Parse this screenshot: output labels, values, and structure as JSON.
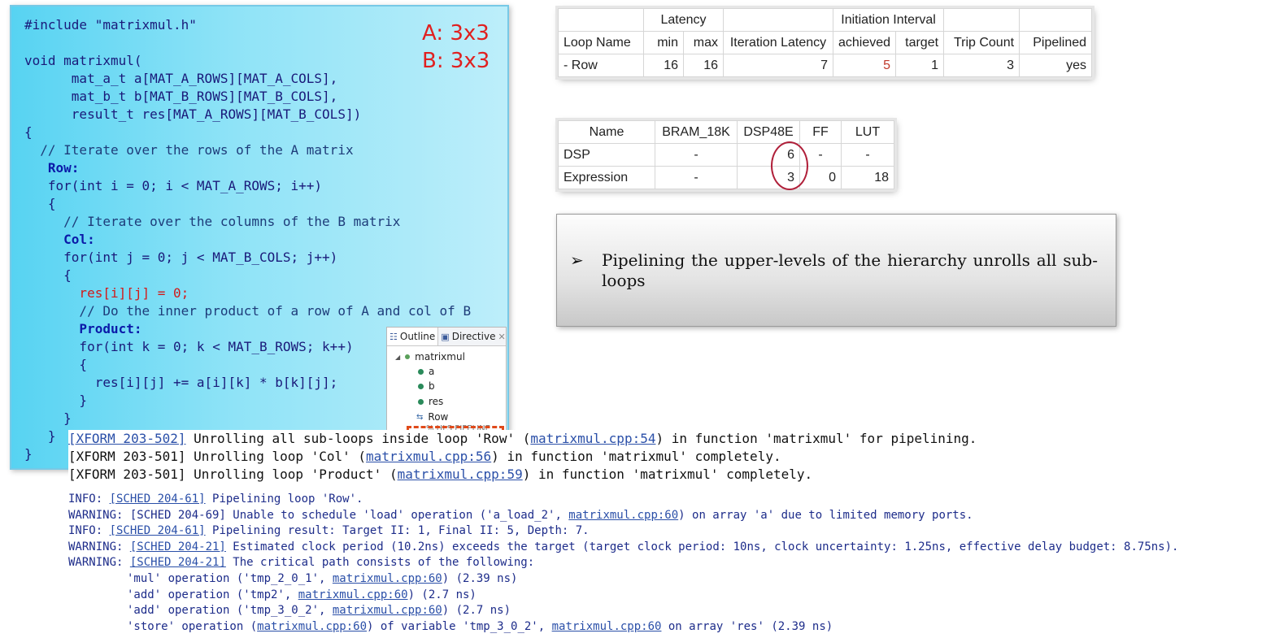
{
  "code": {
    "lines": [
      "#include \"matrixmul.h\"",
      "",
      "void matrixmul(",
      "      mat_a_t a[MAT_A_ROWS][MAT_A_COLS],",
      "      mat_b_t b[MAT_B_ROWS][MAT_B_COLS],",
      "      result_t res[MAT_A_ROWS][MAT_B_COLS])",
      "{",
      "  // Iterate over the rows of the A matrix",
      "   Row:",
      "   for(int i = 0; i < MAT_A_ROWS; i++)",
      "   {",
      "     // Iterate over the columns of the B matrix",
      "     Col:",
      "     for(int j = 0; j < MAT_B_COLS; j++)",
      "     {",
      "       res[i][j] = 0;",
      "       // Do the inner product of a row of A and col of B",
      "       Product:",
      "       for(int k = 0; k < MAT_B_ROWS; k++)",
      "       {",
      "         res[i][j] += a[i][k] * b[k][j];",
      "       }",
      "     }",
      "   }",
      "}"
    ],
    "size_a": "A: 3x3",
    "size_b": "B: 3x3"
  },
  "outline": {
    "tab_outline": "Outline",
    "tab_directive": "Directive",
    "root": "matrixmul",
    "items": [
      "a",
      "b",
      "res"
    ],
    "selected": "Row",
    "sub": "% HLS PIPELINE"
  },
  "latency_table": {
    "group_latency": "Latency",
    "group_ii": "Initiation Interval",
    "headers": [
      "Loop Name",
      "min",
      "max",
      "Iteration Latency",
      "achieved",
      "target",
      "Trip Count",
      "Pipelined"
    ],
    "row": [
      "- Row",
      "16",
      "16",
      "7",
      "5",
      "1",
      "3",
      "yes"
    ]
  },
  "resource_table": {
    "headers": [
      "Name",
      "BRAM_18K",
      "DSP48E",
      "FF",
      "LUT"
    ],
    "rows": [
      [
        "DSP",
        "-",
        "6",
        "-",
        "-"
      ],
      [
        "Expression",
        "-",
        "3",
        "0",
        "18"
      ]
    ]
  },
  "note": {
    "bullet": "➢",
    "text": "Pipelining the upper-levels of the hierarchy unrolls all sub-loops"
  },
  "xform": {
    "l1_tag": "[XFORM 203-502]",
    "l1_a": " Unrolling all sub-loops inside loop 'Row' (",
    "l1_link": "matrixmul.cpp:54",
    "l1_b": ") in function 'matrixmul' for pipelining.",
    "l2_a": "[XFORM 203-501] Unrolling loop 'Col' (",
    "l2_link": "matrixmul.cpp:56",
    "l2_b": ") in function 'matrixmul' completely.",
    "l3_a": "[XFORM 203-501] Unrolling loop 'Product' (",
    "l3_link": "matrixmul.cpp:59",
    "l3_b": ") in function 'matrixmul' completely."
  },
  "log": {
    "i1_a": "INFO: ",
    "i1_link": "[SCHED 204-61]",
    "i1_b": " Pipelining loop 'Row'.",
    "w1_a": "WARNING: [SCHED 204-69] Unable to schedule 'load' operation ('a_load_2', ",
    "w1_link": "matrixmul.cpp:60",
    "w1_b": ") on array 'a' due to limited memory ports.",
    "i2_a": "INFO: ",
    "i2_link": "[SCHED 204-61]",
    "i2_b": " Pipelining result: Target II: 1, Final II: 5, Depth: 7.",
    "w2_a": "WARNING: ",
    "w2_link": "[SCHED 204-21]",
    "w2_b": " Estimated clock period (10.2ns) exceeds the target (target clock period: 10ns, clock uncertainty: 1.25ns, effective delay budget: 8.75ns).",
    "w3_a": "WARNING: ",
    "w3_link": "[SCHED 204-21]",
    "w3_b": " The critical path consists of the following:",
    "p1_a": "'mul' operation ('tmp_2_0_1', ",
    "p1_link": "matrixmul.cpp:60",
    "p1_b": ") (2.39 ns)",
    "p2_a": "'add' operation ('tmp2', ",
    "p2_link": "matrixmul.cpp:60",
    "p2_b": ") (2.7 ns)",
    "p3_a": "'add' operation ('tmp_3_0_2', ",
    "p3_link": "matrixmul.cpp:60",
    "p3_b": ") (2.7 ns)",
    "p4_a": "'store' operation (",
    "p4_link": "matrixmul.cpp:60",
    "p4_b": ") of variable 'tmp_3_0_2', ",
    "p4_link2": "matrixmul.cpp:60",
    "p4_c": " on array 'res' (2.39 ns)"
  }
}
